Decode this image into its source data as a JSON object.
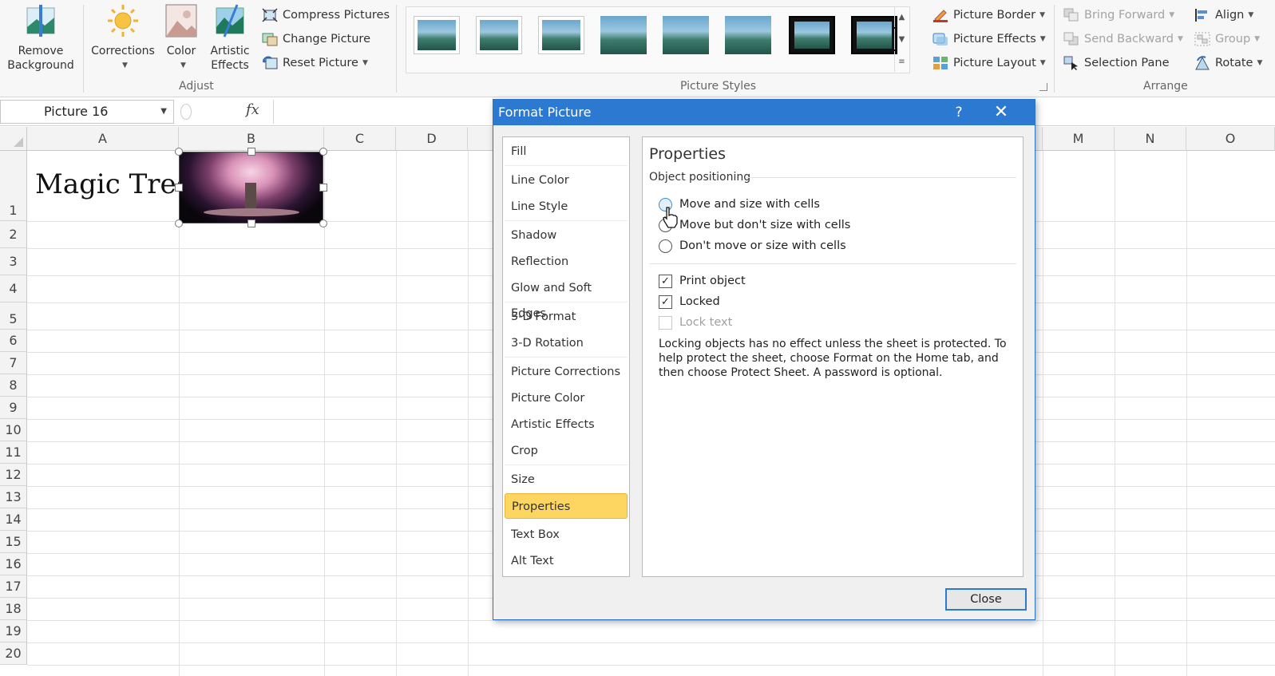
{
  "ribbon": {
    "adjust": {
      "remove_background": "Remove Background",
      "corrections": "Corrections",
      "color": "Color",
      "artistic_effects": "Artistic Effects",
      "compress_pictures": "Compress Pictures",
      "change_picture": "Change Picture",
      "reset_picture": "Reset Picture",
      "group_label": "Adjust"
    },
    "picture_styles": {
      "picture_border": "Picture Border",
      "picture_effects": "Picture Effects",
      "picture_layout": "Picture Layout",
      "group_label": "Picture Styles"
    },
    "arrange": {
      "bring_forward": "Bring Forward",
      "send_backward": "Send Backward",
      "selection_pane": "Selection Pane",
      "align": "Align",
      "group": "Group",
      "rotate": "Rotate",
      "group_label": "Arrange"
    }
  },
  "formula_bar": {
    "name_box": "Picture 16",
    "fx": "fx"
  },
  "sheet": {
    "columns": [
      "A",
      "B",
      "C",
      "D",
      "M",
      "N",
      "O"
    ],
    "rows": [
      "1",
      "2",
      "3",
      "4",
      "5",
      "6",
      "7",
      "8",
      "9",
      "10",
      "11",
      "12",
      "13",
      "14",
      "15",
      "16",
      "17",
      "18",
      "19",
      "20"
    ],
    "cell_a1": "Magic Tree"
  },
  "dialog": {
    "title": "Format Picture",
    "help": "?",
    "nav_items": [
      "Fill",
      "Line Color",
      "Line Style",
      "Shadow",
      "Reflection",
      "Glow and Soft Edges",
      "3-D Format",
      "3-D Rotation",
      "Picture Corrections",
      "Picture Color",
      "Artistic Effects",
      "Crop",
      "Size",
      "Properties",
      "Text Box",
      "Alt Text"
    ],
    "selected_nav": "Properties",
    "panel": {
      "title": "Properties",
      "section": "Object positioning",
      "radio_move_size": "Move and size with cells",
      "radio_move_only": "Move but don't size with cells",
      "radio_dont_move": "Don't move or size with cells",
      "print_object": "Print object",
      "locked": "Locked",
      "lock_text": "Lock text",
      "note": "Locking objects has no effect unless the sheet is protected. To help protect the sheet, choose Format on the Home tab, and then choose Protect Sheet. A password is optional."
    },
    "close_button": "Close"
  },
  "colors": {
    "dialog_titlebar": "#2b79d0",
    "selected_nav": "#fdd662"
  }
}
